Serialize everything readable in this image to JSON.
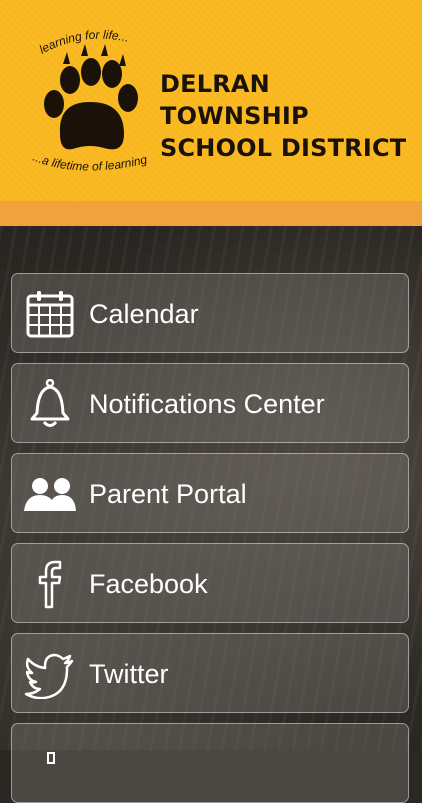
{
  "header": {
    "logo_tagline_top": "learning for life...",
    "logo_tagline_bottom": "...a lifetime of learning",
    "district_line1": "DELRAN TOWNSHIP",
    "district_line2": "SCHOOL DISTRICT"
  },
  "menu": [
    {
      "label": "Calendar",
      "icon": "calendar-icon"
    },
    {
      "label": "Notifications Center",
      "icon": "bell-icon"
    },
    {
      "label": "Parent Portal",
      "icon": "users-icon"
    },
    {
      "label": "Facebook",
      "icon": "facebook-icon"
    },
    {
      "label": "Twitter",
      "icon": "twitter-icon"
    }
  ],
  "colors": {
    "header_bg": "#f9b71e",
    "stripe": "#f0a33c",
    "text_dark": "#1a1208",
    "menu_text": "#ffffff"
  }
}
